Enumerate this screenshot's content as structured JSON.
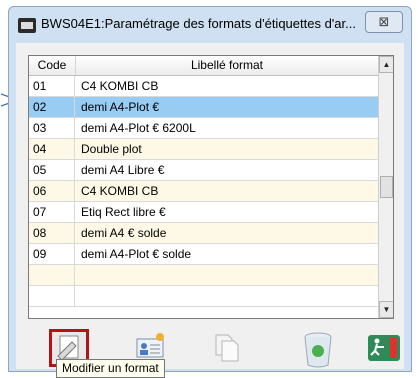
{
  "window": {
    "title": "BWS04E1:Paramétrage des formats d'étiquettes d'ar...",
    "close_symbol": "⊠"
  },
  "grid": {
    "columns": [
      "Code",
      "Libellé format"
    ],
    "rows": [
      {
        "code": "01",
        "label": "C4 KOMBI CB"
      },
      {
        "code": "02",
        "label": "demi A4-Plot €"
      },
      {
        "code": "03",
        "label": "demi A4-Plot € 6200L"
      },
      {
        "code": "04",
        "label": "Double plot"
      },
      {
        "code": "05",
        "label": "demi A4 Libre €"
      },
      {
        "code": "06",
        "label": "C4 KOMBI CB"
      },
      {
        "code": "07",
        "label": "Etiq Rect libre €"
      },
      {
        "code": "08",
        "label": "demi A4 € solde"
      },
      {
        "code": "09",
        "label": "demi A4-Plot € solde"
      }
    ],
    "selected_index": 1,
    "scroll_up": "▲",
    "scroll_down": "▼"
  },
  "toolbar": {
    "buttons": [
      "modify-format",
      "new-format",
      "copy-format",
      "delete-format",
      "exit"
    ]
  },
  "tooltip": {
    "text": "Modifier un format"
  },
  "colors": {
    "selected_row": "#99ccf3",
    "alt_row": "#fdf9e6",
    "highlight_border": "#b01414"
  }
}
